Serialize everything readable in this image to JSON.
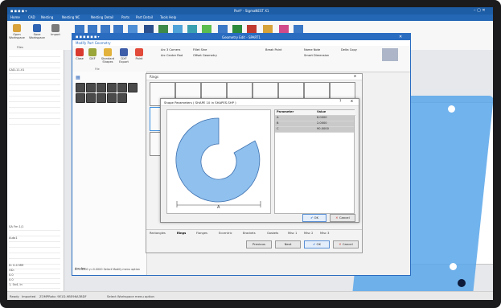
{
  "main": {
    "title": "Part* - SigmaNEST X1",
    "menu": [
      "Home",
      "CAD",
      "Nesting",
      "Nesting NC",
      "Nesting Detail",
      "Parts",
      "Part Detail",
      "Tools Help"
    ],
    "ribbon": [
      {
        "label": "Open Workspace",
        "color": "#d9a23a",
        "icon": "folder-icon"
      },
      {
        "label": "Save Workspace",
        "color": "#2f63b3",
        "icon": "save-icon"
      },
      {
        "label": "Import",
        "color": "#7a7a7a",
        "icon": "import-icon"
      }
    ],
    "files_label": "Files",
    "left_rows": [
      "",
      "",
      "",
      "CAD-11-V1",
      "",
      "",
      "",
      "",
      "",
      "",
      "",
      "",
      ""
    ],
    "left_bottom_rows": [
      "SA Fm 1/1",
      "",
      "Auto1",
      "",
      "",
      "",
      "",
      "D: 0.4 MM",
      "OD:",
      "0.0",
      "0.0",
      "1, 0x4, in",
      "0.0001 in",
      "Th: 4 8 m in*"
    ],
    "status": [
      "Ready",
      "Imported",
      "ZOMPRoto: 9E1D-9BE96A3BDF",
      "Select Workspace menu option"
    ]
  },
  "geom_window": {
    "title": "Geometry Edit - SPART1",
    "tab": "Modify Part Geometry",
    "ribbon": [
      {
        "label": "Close",
        "color": "#d93a2f",
        "icon": "close-icon"
      },
      {
        "label": "DXF",
        "color": "#9aa53a",
        "icon": "dxf-icon"
      },
      {
        "label": "Standard Shapes",
        "color": "#e2b23c",
        "icon": "shapes-icon"
      },
      {
        "label": "DXF Export",
        "color": "#3d5da8",
        "icon": "export-icon"
      },
      {
        "label": "Point",
        "color": "#e24a3a",
        "icon": "point-icon"
      }
    ],
    "tools_row1": [
      "Arc 3 Corners",
      "Fillet Sine",
      "Break Point",
      "Name Note",
      "Delta Copy"
    ],
    "tools_row2": [
      "Arc Center Rad",
      "Offset Geometry",
      "Smart Dimension"
    ],
    "file_label": "File",
    "bottom_text": "Arc 4m",
    "status_text": "x=0.4000 y=0.0000  Select Modify menu option"
  },
  "shapes_dialog": {
    "title": "Rings",
    "close": "x",
    "tabs": [
      "Rectangles",
      "Rings",
      "Flanges",
      "Eccentric",
      "Brackets",
      "Gaskets",
      "Misc 1",
      "Misc 2",
      "Misc 3"
    ],
    "buttons": {
      "previous": "Previous",
      "next": "Next",
      "ok": "OK",
      "cancel": "Cancel"
    }
  },
  "shape_params": {
    "title": "Shape Parameters ( SHAPE 10 in SHAPES.SHP )",
    "help": "?",
    "close": "x",
    "columns": [
      "Parameter",
      "Value"
    ],
    "rows": [
      {
        "param": "A",
        "value": "6.0000"
      },
      {
        "param": "B",
        "value": "2.0000"
      },
      {
        "param": "C",
        "value": "90.0000"
      }
    ],
    "dimension_label": "A",
    "buttons": {
      "ok": "OK",
      "cancel": "Cancel"
    }
  }
}
